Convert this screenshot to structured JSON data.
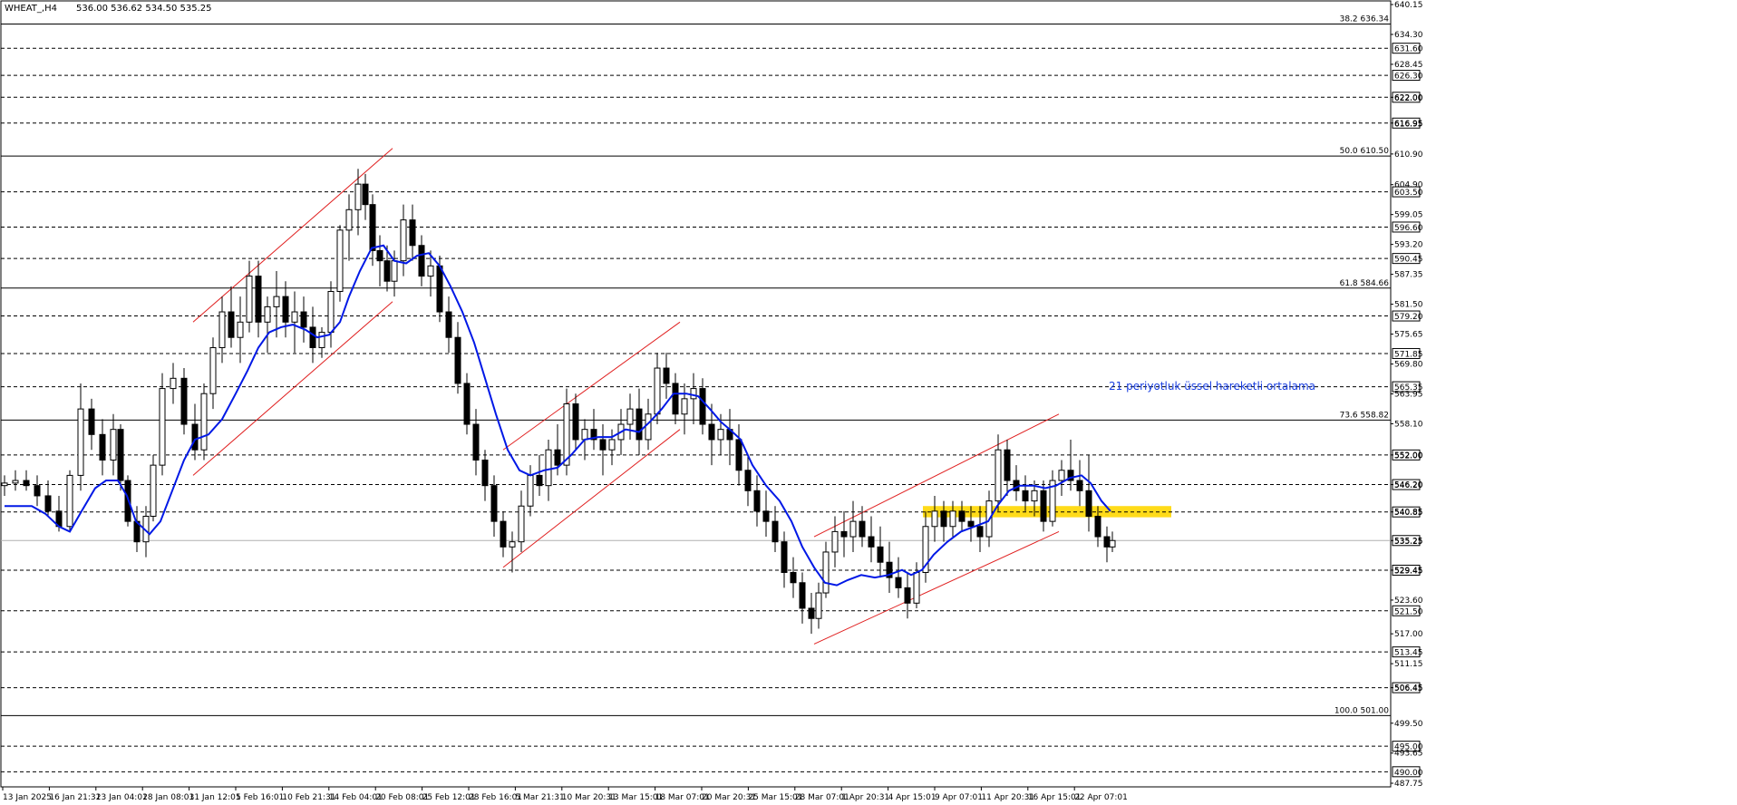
{
  "header": {
    "symbol_timeframe": "WHEAT_,H4",
    "ohlc": "536.00 536.62 534.50 535.25"
  },
  "annotation": {
    "text": "21 periyotluk üssel hareketli ortalama",
    "color": "#1a3fe0"
  },
  "colors": {
    "ema": "#0018e6",
    "channel": "#e02020",
    "zone": "#ffd700",
    "candle": "#000000"
  },
  "chart_data": {
    "type": "candlestick",
    "instrument": "WHEAT_",
    "timeframe": "H4",
    "ylim": [
      487.75,
      640.15
    ],
    "grid": false,
    "price_scale_labels": [
      "640.15",
      "634.30",
      "628.45",
      "622.00",
      "616.95",
      "610.90",
      "604.90",
      "599.05",
      "593.20",
      "587.35",
      "581.50",
      "575.65",
      "569.80",
      "563.95",
      "558.10",
      "552.00",
      "546.20",
      "540.85",
      "535.25",
      "529.45",
      "523.60",
      "517.00",
      "511.15",
      "506.45",
      "499.50",
      "493.65",
      "487.75"
    ],
    "x_tick_labels": [
      "13 Jan 2025",
      "16 Jan 21:31",
      "23 Jan 04:01",
      "28 Jan 08:01",
      "31 Jan 12:01",
      "5 Feb 16:01",
      "10 Feb 21:31",
      "14 Feb 04:01",
      "20 Feb 08:01",
      "25 Feb 12:01",
      "28 Feb 16:01",
      "5 Mar 21:31",
      "10 Mar 20:31",
      "13 Mar 15:01",
      "18 Mar 07:01",
      "20 Mar 20:31",
      "25 Mar 15:01",
      "28 Mar 07:01",
      "1 Apr 20:31",
      "4 Apr 15:01",
      "9 Apr 07:01",
      "11 Apr 20:31",
      "16 Apr 15:01",
      "22 Apr 07:01"
    ],
    "horizontal_levels": [
      {
        "price": 631.6,
        "label": "631.60"
      },
      {
        "price": 626.3,
        "label": "626.30"
      },
      {
        "price": 622.0,
        "label": "622.00"
      },
      {
        "price": 616.95,
        "label": "616.95"
      },
      {
        "price": 603.5,
        "label": "603.50"
      },
      {
        "price": 596.6,
        "label": "596.60"
      },
      {
        "price": 590.45,
        "label": "590.45"
      },
      {
        "price": 579.2,
        "label": "579.20"
      },
      {
        "price": 571.85,
        "label": "571.85"
      },
      {
        "price": 565.35,
        "label": "565.35"
      },
      {
        "price": 552.0,
        "label": "552.00"
      },
      {
        "price": 546.2,
        "label": "546.20"
      },
      {
        "price": 540.85,
        "label": "540.85"
      },
      {
        "price": 529.45,
        "label": "529.45"
      },
      {
        "price": 521.5,
        "label": "521.50"
      },
      {
        "price": 513.45,
        "label": "513.45"
      },
      {
        "price": 506.45,
        "label": "506.45"
      },
      {
        "price": 495.0,
        "label": "495.00"
      },
      {
        "price": 490.0,
        "label": "490.00"
      }
    ],
    "fibonacci_levels": [
      {
        "label": "38.2 636.34",
        "price": 636.34
      },
      {
        "label": "50.0 610.50",
        "price": 610.5
      },
      {
        "label": "61.8 584.66",
        "price": 584.66
      },
      {
        "label": "73.6 558.82",
        "price": 558.82
      },
      {
        "label": "100.0 501.00",
        "price": 501.0
      }
    ],
    "current_price": {
      "price": 535.25,
      "label": "535.25"
    },
    "resistance_zone": {
      "low": 539.8,
      "high": 542.0
    },
    "ema_period": 21,
    "ema_path": [
      [
        0,
        542
      ],
      [
        30,
        542
      ],
      [
        45,
        540.5
      ],
      [
        60,
        538
      ],
      [
        72,
        537
      ],
      [
        85,
        541
      ],
      [
        100,
        545.5
      ],
      [
        112,
        547
      ],
      [
        125,
        547
      ],
      [
        135,
        544
      ],
      [
        145,
        539
      ],
      [
        160,
        536.5
      ],
      [
        172,
        539
      ],
      [
        185,
        545
      ],
      [
        198,
        551
      ],
      [
        210,
        555
      ],
      [
        225,
        556
      ],
      [
        240,
        559
      ],
      [
        255,
        564
      ],
      [
        268,
        568.5
      ],
      [
        280,
        573
      ],
      [
        292,
        576
      ],
      [
        305,
        577
      ],
      [
        318,
        577.5
      ],
      [
        332,
        576.5
      ],
      [
        345,
        575
      ],
      [
        358,
        575.5
      ],
      [
        370,
        578
      ],
      [
        380,
        583
      ],
      [
        392,
        588
      ],
      [
        405,
        592.5
      ],
      [
        418,
        593
      ],
      [
        430,
        590
      ],
      [
        443,
        589.5
      ],
      [
        455,
        591
      ],
      [
        468,
        591.5
      ],
      [
        480,
        589
      ],
      [
        492,
        585
      ],
      [
        505,
        580
      ],
      [
        518,
        574
      ],
      [
        530,
        567
      ],
      [
        542,
        560
      ],
      [
        555,
        553
      ],
      [
        568,
        549
      ],
      [
        580,
        548
      ],
      [
        595,
        549
      ],
      [
        610,
        549.5
      ],
      [
        625,
        552
      ],
      [
        640,
        555
      ],
      [
        655,
        555.5
      ],
      [
        670,
        555.5
      ],
      [
        685,
        557
      ],
      [
        700,
        556.5
      ],
      [
        712,
        558.5
      ],
      [
        725,
        561
      ],
      [
        738,
        564
      ],
      [
        752,
        564
      ],
      [
        765,
        563.5
      ],
      [
        778,
        561
      ],
      [
        790,
        558.5
      ],
      [
        800,
        557
      ],
      [
        812,
        555
      ],
      [
        825,
        550
      ],
      [
        840,
        546
      ],
      [
        855,
        543
      ],
      [
        868,
        539
      ],
      [
        880,
        534
      ],
      [
        893,
        530
      ],
      [
        905,
        527
      ],
      [
        918,
        526.5
      ],
      [
        930,
        527.5
      ],
      [
        945,
        528.5
      ],
      [
        960,
        528
      ],
      [
        975,
        528.5
      ],
      [
        990,
        529.5
      ],
      [
        1000,
        528.5
      ],
      [
        1012,
        529.5
      ],
      [
        1025,
        532.5
      ],
      [
        1040,
        535
      ],
      [
        1055,
        537
      ],
      [
        1070,
        538
      ],
      [
        1085,
        539
      ],
      [
        1095,
        542
      ],
      [
        1108,
        545
      ],
      [
        1120,
        546
      ],
      [
        1135,
        546
      ],
      [
        1148,
        545.5
      ],
      [
        1160,
        546
      ],
      [
        1175,
        547.5
      ],
      [
        1188,
        548
      ],
      [
        1198,
        546.5
      ],
      [
        1210,
        543
      ],
      [
        1220,
        541
      ]
    ],
    "candles": [
      [
        0,
        546,
        548,
        544,
        546.5
      ],
      [
        12,
        546.5,
        549,
        545,
        547
      ],
      [
        24,
        547,
        549,
        545,
        546
      ],
      [
        36,
        546,
        548,
        542,
        544
      ],
      [
        48,
        544,
        547,
        540,
        541
      ],
      [
        60,
        541,
        544,
        537,
        538
      ],
      [
        72,
        538,
        549,
        537,
        548
      ],
      [
        84,
        548,
        566,
        545,
        561
      ],
      [
        96,
        561,
        563,
        553,
        556
      ],
      [
        108,
        556,
        559,
        548,
        551
      ],
      [
        120,
        551,
        560,
        548,
        557
      ],
      [
        128,
        557,
        558,
        545,
        547
      ],
      [
        136,
        547,
        548,
        538,
        539
      ],
      [
        146,
        539,
        542,
        533,
        535
      ],
      [
        156,
        535,
        542,
        532,
        540
      ],
      [
        164,
        540,
        552,
        539,
        550
      ],
      [
        174,
        550,
        568,
        548,
        565
      ],
      [
        186,
        565,
        570,
        562,
        567
      ],
      [
        198,
        567,
        569,
        556,
        558
      ],
      [
        210,
        558,
        562,
        551,
        553
      ],
      [
        220,
        553,
        566,
        551,
        564
      ],
      [
        230,
        564,
        575,
        561,
        573
      ],
      [
        240,
        573,
        583,
        570,
        580
      ],
      [
        250,
        580,
        585,
        573,
        575
      ],
      [
        260,
        575,
        583,
        570,
        578
      ],
      [
        270,
        578,
        590,
        576,
        587
      ],
      [
        280,
        587,
        590,
        575,
        578
      ],
      [
        290,
        578,
        583,
        572,
        581
      ],
      [
        300,
        581,
        588,
        575,
        583
      ],
      [
        310,
        583,
        586,
        575,
        578
      ],
      [
        320,
        578,
        584,
        572,
        580
      ],
      [
        330,
        580,
        583,
        574,
        577
      ],
      [
        340,
        577,
        581,
        570,
        573
      ],
      [
        350,
        573,
        577,
        571,
        576
      ],
      [
        360,
        576,
        586,
        573,
        584
      ],
      [
        370,
        584,
        597,
        582,
        596
      ],
      [
        380,
        596,
        603,
        590,
        600
      ],
      [
        390,
        600,
        608,
        595,
        605
      ],
      [
        398,
        605,
        607,
        598,
        601
      ],
      [
        406,
        601,
        603,
        589,
        592
      ],
      [
        414,
        592,
        595,
        585,
        590
      ],
      [
        422,
        590,
        593,
        584,
        586
      ],
      [
        430,
        586,
        592,
        583,
        590
      ],
      [
        440,
        590,
        601,
        587,
        598
      ],
      [
        450,
        598,
        601,
        590,
        593
      ],
      [
        460,
        593,
        595,
        585,
        587
      ],
      [
        470,
        587,
        592,
        583,
        589
      ],
      [
        480,
        589,
        591,
        578,
        580
      ],
      [
        490,
        580,
        583,
        572,
        575
      ],
      [
        500,
        575,
        578,
        564,
        566
      ],
      [
        510,
        566,
        568,
        556,
        558
      ],
      [
        520,
        558,
        561,
        548,
        551
      ],
      [
        530,
        551,
        553,
        543,
        546
      ],
      [
        540,
        546,
        548,
        536,
        539
      ],
      [
        550,
        539,
        541,
        532,
        534
      ],
      [
        560,
        534,
        537,
        529,
        535
      ],
      [
        570,
        535,
        545,
        533,
        542
      ],
      [
        580,
        542,
        550,
        540,
        548
      ],
      [
        590,
        548,
        552,
        544,
        546
      ],
      [
        600,
        546,
        555,
        543,
        553
      ],
      [
        610,
        553,
        558,
        548,
        550
      ],
      [
        620,
        550,
        565,
        548,
        562
      ],
      [
        630,
        562,
        564,
        553,
        555
      ],
      [
        640,
        555,
        559,
        551,
        557
      ],
      [
        650,
        557,
        561,
        553,
        555
      ],
      [
        660,
        555,
        558,
        548,
        553
      ],
      [
        670,
        553,
        557,
        550,
        555
      ],
      [
        680,
        555,
        561,
        552,
        558
      ],
      [
        690,
        558,
        564,
        555,
        561
      ],
      [
        700,
        561,
        565,
        552,
        555
      ],
      [
        710,
        555,
        563,
        553,
        560
      ],
      [
        720,
        560,
        572,
        558,
        569
      ],
      [
        730,
        569,
        572,
        563,
        566
      ],
      [
        740,
        566,
        568,
        558,
        560
      ],
      [
        750,
        560,
        566,
        556,
        563
      ],
      [
        760,
        563,
        568,
        558,
        565
      ],
      [
        770,
        565,
        567,
        556,
        558
      ],
      [
        780,
        558,
        562,
        550,
        555
      ],
      [
        790,
        555,
        560,
        552,
        557
      ],
      [
        800,
        557,
        561,
        550,
        555
      ],
      [
        810,
        555,
        558,
        546,
        549
      ],
      [
        820,
        549,
        552,
        542,
        545
      ],
      [
        830,
        545,
        548,
        538,
        541
      ],
      [
        840,
        541,
        545,
        536,
        539
      ],
      [
        850,
        539,
        542,
        533,
        535
      ],
      [
        860,
        535,
        537,
        526,
        529
      ],
      [
        870,
        529,
        532,
        524,
        527
      ],
      [
        880,
        527,
        529,
        519,
        522
      ],
      [
        890,
        522,
        525,
        517,
        520
      ],
      [
        898,
        520,
        527,
        518,
        525
      ],
      [
        906,
        525,
        535,
        524,
        533
      ],
      [
        916,
        533,
        540,
        530,
        537
      ],
      [
        926,
        537,
        541,
        532,
        536
      ],
      [
        936,
        536,
        543,
        533,
        539
      ],
      [
        946,
        539,
        542,
        534,
        536
      ],
      [
        956,
        536,
        540,
        531,
        534
      ],
      [
        966,
        534,
        538,
        528,
        531
      ],
      [
        976,
        531,
        535,
        525,
        528
      ],
      [
        986,
        528,
        532,
        524,
        526
      ],
      [
        996,
        526,
        529,
        520,
        523
      ],
      [
        1006,
        523,
        531,
        522,
        529
      ],
      [
        1016,
        529,
        541,
        527,
        538
      ],
      [
        1026,
        538,
        544,
        535,
        541
      ],
      [
        1036,
        541,
        543,
        535,
        538
      ],
      [
        1046,
        538,
        543,
        536,
        541
      ],
      [
        1056,
        541,
        543,
        537,
        539
      ],
      [
        1066,
        539,
        542,
        535,
        538
      ],
      [
        1076,
        538,
        542,
        533,
        536
      ],
      [
        1086,
        536,
        545,
        534,
        543
      ],
      [
        1096,
        543,
        556,
        541,
        553
      ],
      [
        1106,
        553,
        555,
        544,
        547
      ],
      [
        1116,
        547,
        550,
        543,
        545
      ],
      [
        1126,
        545,
        548,
        541,
        543
      ],
      [
        1136,
        543,
        547,
        540,
        545
      ],
      [
        1146,
        545,
        547,
        537,
        539
      ],
      [
        1156,
        539,
        549,
        538,
        547
      ],
      [
        1166,
        547,
        551,
        544,
        549
      ],
      [
        1176,
        549,
        555,
        545,
        547
      ],
      [
        1186,
        547,
        551,
        542,
        545
      ],
      [
        1196,
        545,
        552,
        537,
        540
      ],
      [
        1206,
        540,
        542,
        534,
        536
      ],
      [
        1216,
        536,
        538,
        531,
        534
      ],
      [
        1222,
        534,
        537,
        533,
        535.25
      ]
    ],
    "channels": [
      {
        "name": "",
        "lines": [
          [
            [
              208,
              578
            ],
            [
              428,
              612
            ]
          ],
          [
            [
              208,
              548
            ],
            [
              428,
              582
            ]
          ]
        ]
      },
      {
        "name": "",
        "lines": [
          [
            [
              550,
              553
            ],
            [
              745,
              578
            ]
          ],
          [
            [
              550,
              530
            ],
            [
              745,
              557
            ]
          ]
        ]
      },
      {
        "name": "",
        "lines": [
          [
            [
              893,
              536
            ],
            [
              1163,
              560
            ]
          ],
          [
            [
              893,
              515
            ],
            [
              1163,
              537
            ]
          ]
        ]
      }
    ]
  }
}
